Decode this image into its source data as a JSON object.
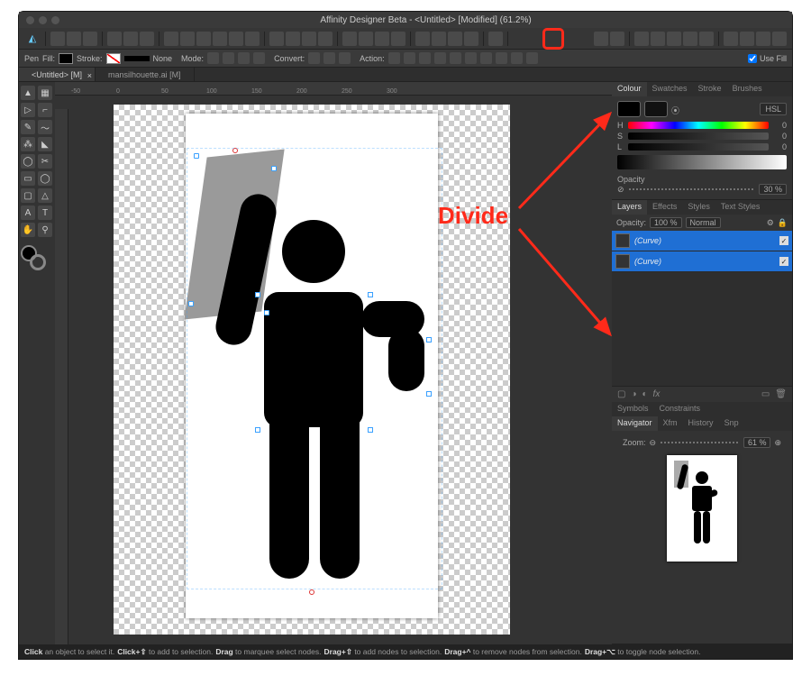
{
  "app_title": "Affinity Designer Beta - <Untitled> [Modified] (61.2%)",
  "toolbar": {
    "divide_tooltip": "Divide"
  },
  "options": {
    "tool": "Pen",
    "fill_label": "Fill:",
    "stroke_label": "Stroke:",
    "stroke_width": "None",
    "mode_label": "Mode:",
    "convert_label": "Convert:",
    "action_label": "Action:",
    "use_fill_label": "Use Fill"
  },
  "tabs": [
    {
      "label": "<Untitled> [M]",
      "active": true
    },
    {
      "label": "mansilhouette.ai [M]",
      "active": false
    }
  ],
  "ruler_marks": [
    "-50",
    "0",
    "50",
    "100",
    "150",
    "200",
    "250",
    "300"
  ],
  "annotation": {
    "text": "Divide"
  },
  "color_panel": {
    "tabs": [
      "Colour",
      "Swatches",
      "Stroke",
      "Brushes"
    ],
    "model": "HSL",
    "h": 0,
    "s": 0,
    "l": 0,
    "opacity_label": "Opacity",
    "opacity": "30 %"
  },
  "layers_panel": {
    "tabs": [
      "Layers",
      "Effects",
      "Styles",
      "Text Styles"
    ],
    "opacity_label": "Opacity:",
    "opacity_value": "100 %",
    "blend_mode": "Normal",
    "items": [
      {
        "name": "(Curve)",
        "visible": true
      },
      {
        "name": "(Curve)",
        "visible": true
      }
    ]
  },
  "bottom_tabs_a": [
    "Symbols",
    "Constraints"
  ],
  "bottom_tabs_b": [
    "Navigator",
    "Xfm",
    "History",
    "Snp"
  ],
  "navigator": {
    "zoom_label": "Zoom:",
    "zoom": "61 %"
  },
  "status": {
    "parts": [
      {
        "b": "Click",
        "t": " an object to select it. "
      },
      {
        "b": "Click+⇧",
        "t": " to add to selection. "
      },
      {
        "b": "Drag",
        "t": " to marquee select nodes. "
      },
      {
        "b": "Drag+⇧",
        "t": " to add nodes to selection. "
      },
      {
        "b": "Drag+^",
        "t": " to remove nodes from selection. "
      },
      {
        "b": "Drag+⌥",
        "t": " to toggle node selection."
      }
    ]
  }
}
